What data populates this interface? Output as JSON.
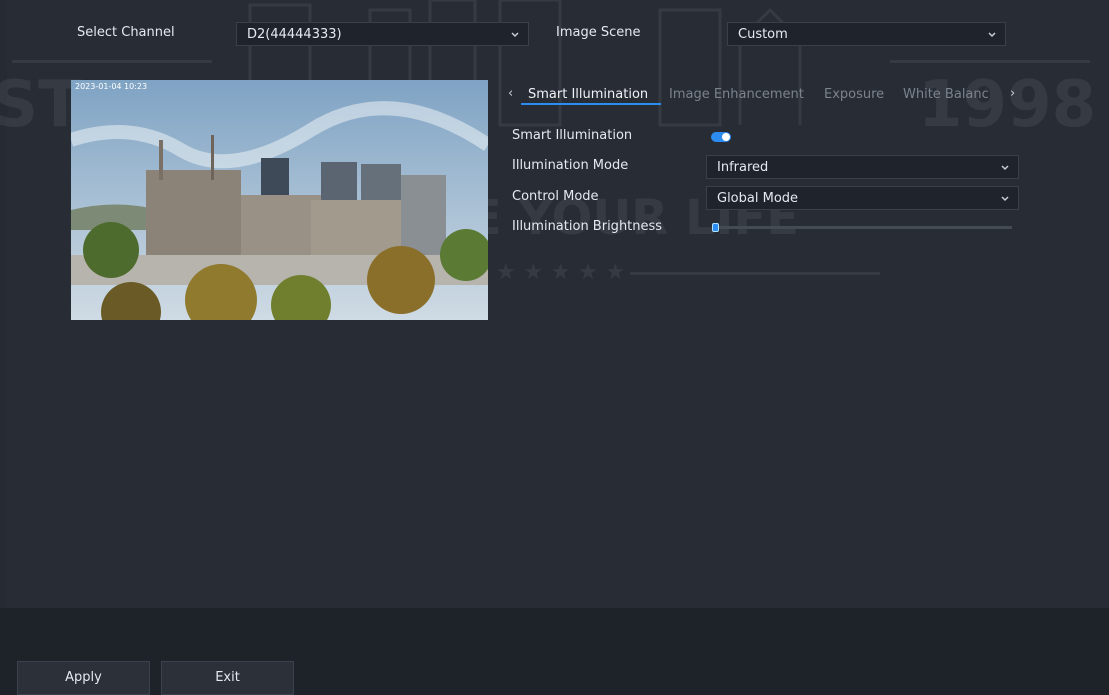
{
  "header": {
    "select_channel_label": "Select Channel",
    "channel_value": "D2(44444333)",
    "image_scene_label": "Image Scene",
    "image_scene_value": "Custom"
  },
  "preview": {
    "timestamp": "2023-01-04 10:23"
  },
  "tabs": {
    "prev_arrow": "‹",
    "next_arrow": "›",
    "items": [
      {
        "label": "Smart Illumination",
        "active": true
      },
      {
        "label": "Image Enhancement",
        "active": false
      },
      {
        "label": "Exposure",
        "active": false
      },
      {
        "label": "White Balanc",
        "active": false
      }
    ]
  },
  "settings": {
    "smart_illumination_label": "Smart Illumination",
    "smart_illumination_on": true,
    "illumination_mode_label": "Illumination Mode",
    "illumination_mode_value": "Infrared",
    "control_mode_label": "Control Mode",
    "control_mode_value": "Global Mode",
    "brightness_label": "Illumination Brightness",
    "brightness_level": 0
  },
  "footer": {
    "apply_label": "Apply",
    "exit_label": "Exit"
  },
  "watermark": {
    "left": "ST.",
    "right": "1998",
    "center": "WE SECURE YOUR LIFE",
    "stars": "★ ★ ★ ★ ★"
  },
  "colors": {
    "accent": "#2d8cf0",
    "background": "#272c35",
    "footer": "#1e2229"
  },
  "icons": {
    "dropdown": "chevron-down-icon",
    "tab_prev": "chevron-left-icon",
    "tab_next": "chevron-right-icon"
  }
}
